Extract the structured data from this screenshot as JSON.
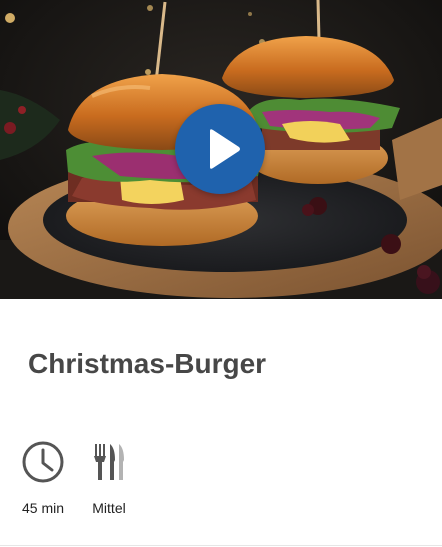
{
  "recipe": {
    "title": "Christmas-Burger",
    "time": {
      "icon": "clock-icon",
      "label": "45 min"
    },
    "difficulty": {
      "icon": "cutlery-icon",
      "label": "Mittel"
    }
  },
  "video": {
    "icon": "play-icon"
  },
  "colors": {
    "play_button": "#1f62ad",
    "title_text": "#474747",
    "meta_icon": "#555555",
    "meta_text": "#222222"
  }
}
